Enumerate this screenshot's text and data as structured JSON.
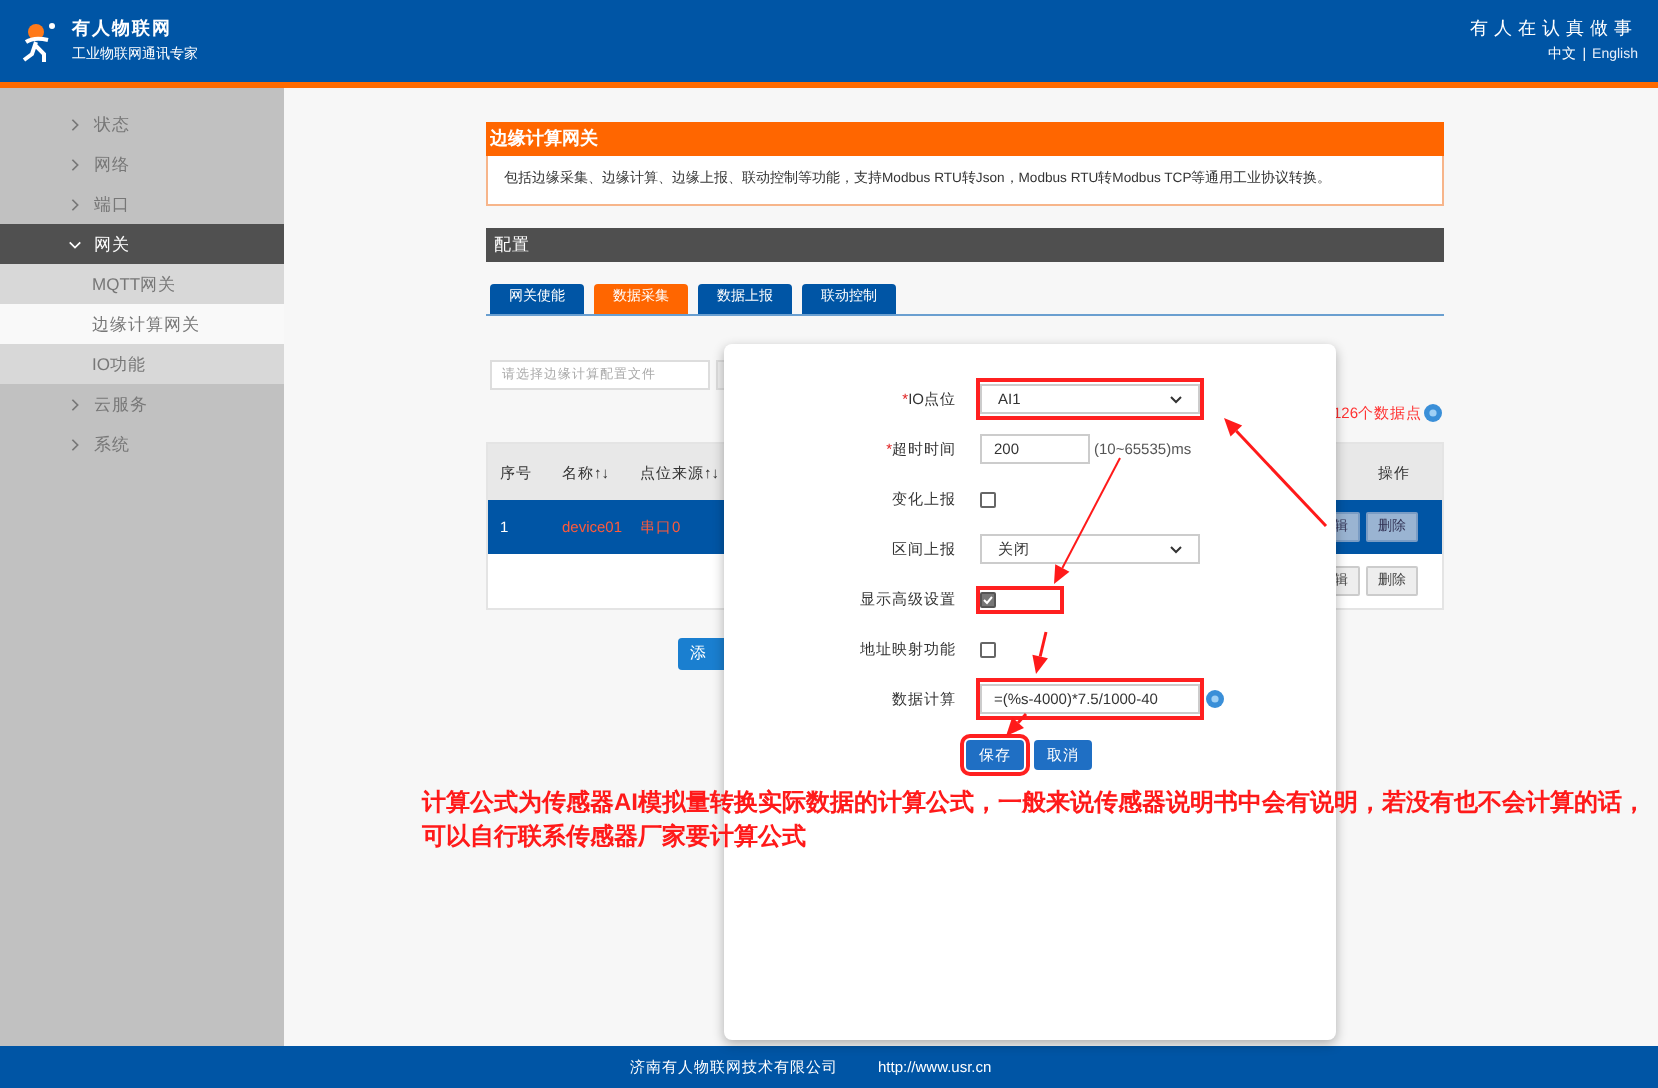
{
  "header": {
    "brand": "有人物联网",
    "tagline": "工业物联网通讯专家",
    "slogan": "有人在认真做事",
    "languages": [
      {
        "label": "中文",
        "selected": true
      },
      {
        "label": "English",
        "selected": false
      }
    ],
    "separator": "|"
  },
  "sidebar": {
    "items": [
      {
        "label": "状态",
        "expanded": false
      },
      {
        "label": "网络",
        "expanded": false
      },
      {
        "label": "端口",
        "expanded": false
      },
      {
        "label": "网关",
        "expanded": true,
        "children": [
          {
            "label": "MQTT网关",
            "selected": false
          },
          {
            "label": "边缘计算网关",
            "selected": true
          },
          {
            "label": "IO功能",
            "selected": false
          }
        ]
      },
      {
        "label": "云服务",
        "expanded": false
      },
      {
        "label": "系统",
        "expanded": false
      }
    ]
  },
  "panel": {
    "title": "边缘计算网关",
    "description": "包括边缘采集、边缘计算、边缘上报、联动控制等功能，支持Modbus RTU转Json，Modbus RTU转Modbus TCP等通用工业协议转换。",
    "config_title": "配置",
    "tabs": [
      {
        "label": "网关使能",
        "selected": false
      },
      {
        "label": "数据采集",
        "selected": true
      },
      {
        "label": "数据上报",
        "selected": false
      },
      {
        "label": "联动控制",
        "selected": false
      }
    ],
    "file_field": {
      "placeholder": "请选择边缘计算配置文件"
    },
    "data_points": "126个数据点",
    "table": {
      "columns": [
        "序号",
        "名称↑↓",
        "点位来源↑↓",
        "操作"
      ],
      "rows": [
        {
          "cells": [
            "1",
            "device01",
            "串口0"
          ],
          "selected": true,
          "actions": [
            "辑",
            "删除"
          ]
        },
        {
          "cells": [],
          "selected": false,
          "actions": [
            "辑",
            "删除"
          ]
        }
      ]
    },
    "add_button": "添"
  },
  "modal": {
    "fields": [
      {
        "kind": "select",
        "required_mark": "*",
        "label": "IO点位",
        "value": "AI1",
        "highlighted": true
      },
      {
        "kind": "text",
        "required_mark": "*",
        "label": "超时时间",
        "value": "200",
        "suffix": "(10~65535)ms",
        "highlighted": false
      },
      {
        "kind": "checkbox",
        "label": "变化上报",
        "checked": false,
        "highlighted": false
      },
      {
        "kind": "select",
        "label": "区间上报",
        "value": "关闭",
        "highlighted": false
      },
      {
        "kind": "checkbox",
        "label": "显示高级设置",
        "checked": true,
        "highlighted": true
      },
      {
        "kind": "checkbox",
        "label": "地址映射功能",
        "checked": false,
        "highlighted": false
      },
      {
        "kind": "text",
        "label": "数据计算",
        "value": "=(%s-4000)*7.5/1000-40",
        "help": true,
        "highlighted": true
      }
    ],
    "buttons": [
      {
        "label": "保存",
        "highlighted": true
      },
      {
        "label": "取消",
        "highlighted": false
      }
    ]
  },
  "annotation": {
    "lines": [
      "计算公式为传感器AI模拟量转换实际数据的计算公式，一般来说传感器说明书中会有说明，若没有也不会计算的话，",
      "可以自行联系传感器厂家要计算公式"
    ]
  },
  "footer": {
    "company": "济南有人物联网技术有限公司",
    "url": "http://www.usr.cn"
  }
}
